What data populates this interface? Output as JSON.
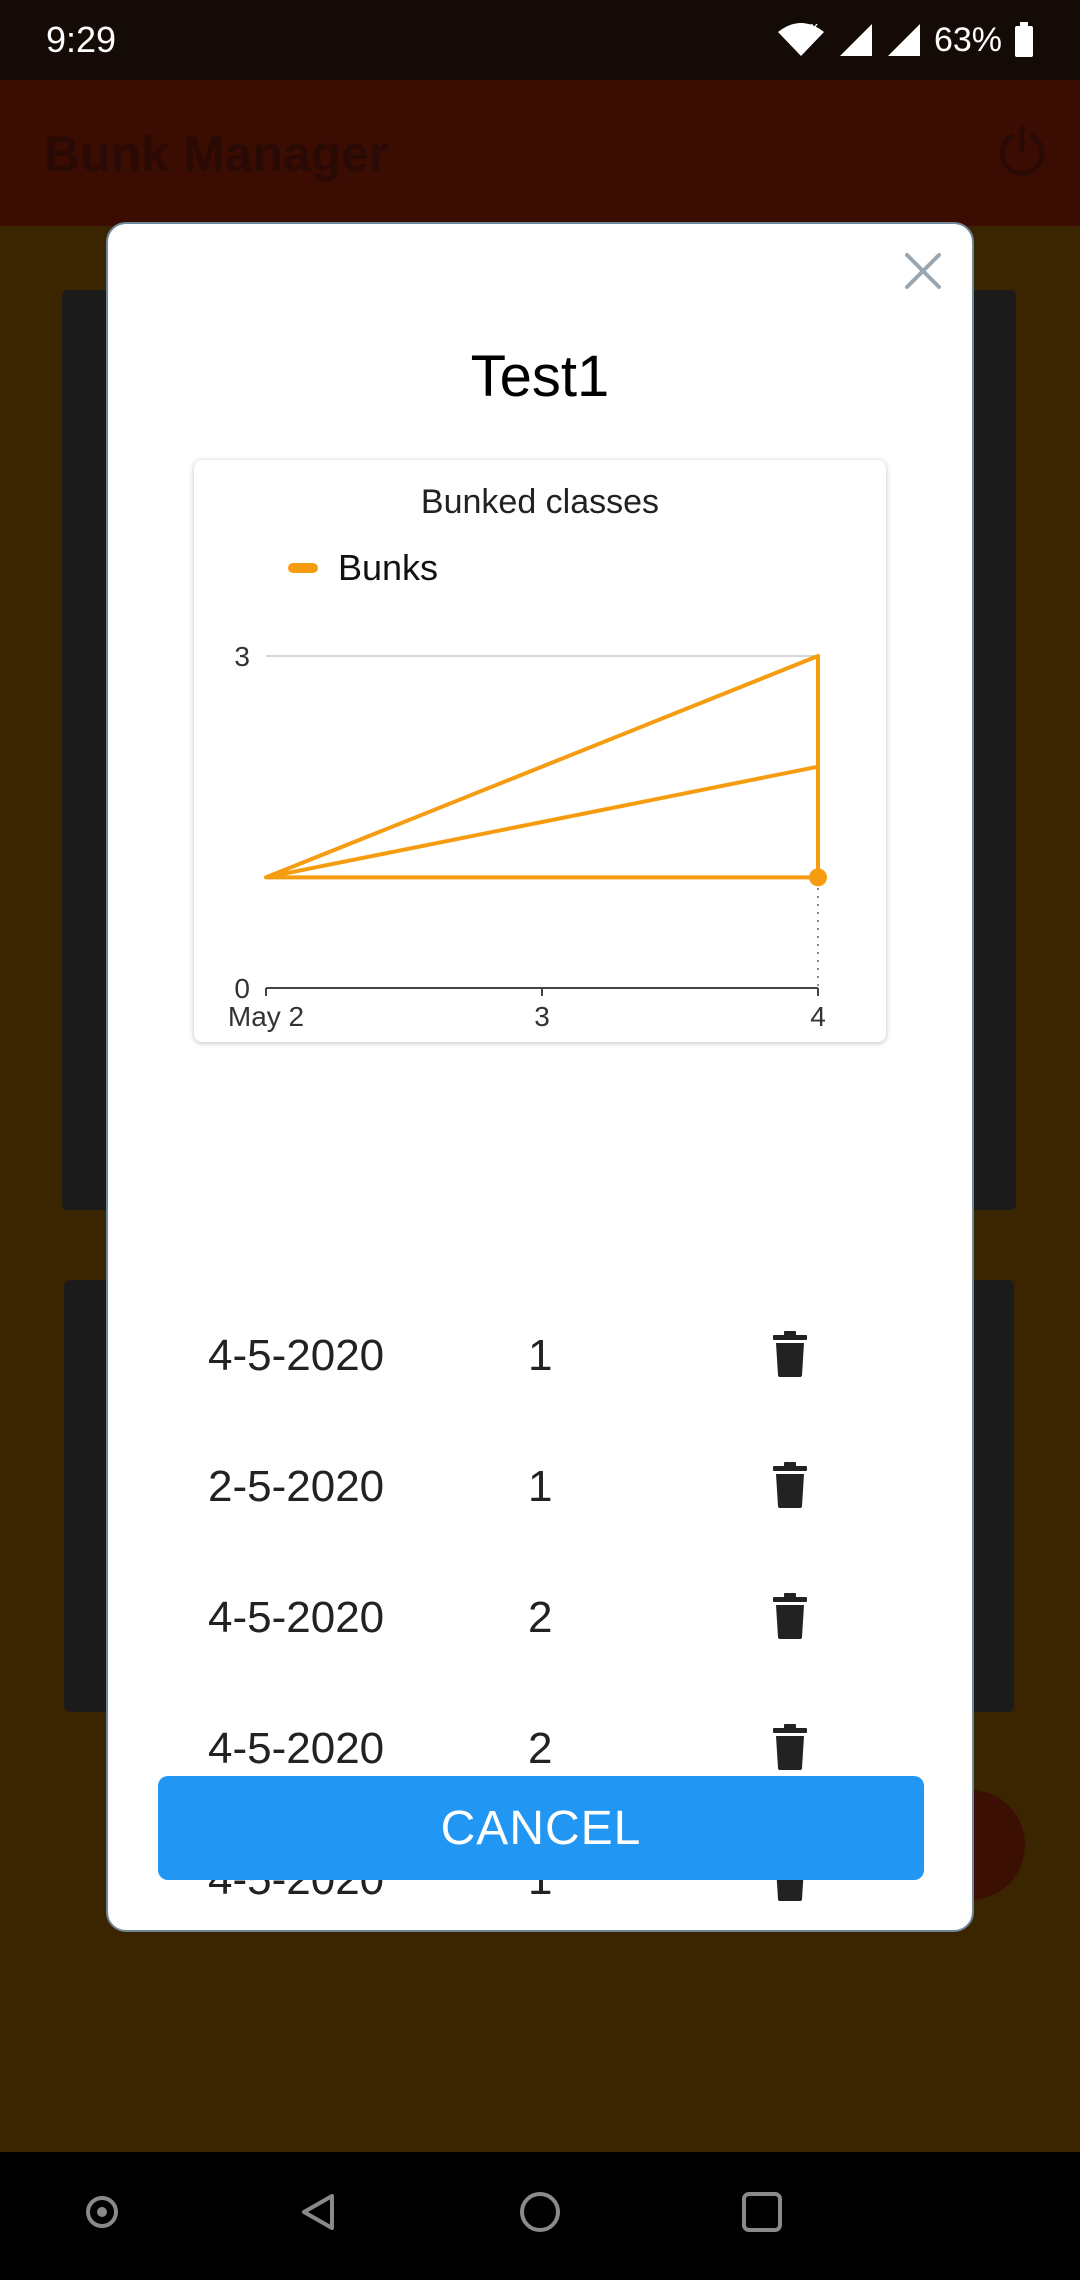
{
  "status_bar": {
    "time": "9:29",
    "battery": "63%",
    "icons": [
      "wifi-icon",
      "signal-icon",
      "signal-icon",
      "battery-icon"
    ]
  },
  "app": {
    "title": "Bunk Manager",
    "icons": [
      "power-icon"
    ]
  },
  "dialog": {
    "title": "Test1",
    "close_icon": "close-icon",
    "chart_title": "Bunked classes",
    "legend_label": "Bunks",
    "cancel_label": "CANCEL",
    "entries": [
      {
        "date": "4-5-2020",
        "count": "1"
      },
      {
        "date": "2-5-2020",
        "count": "1"
      },
      {
        "date": "4-5-2020",
        "count": "2"
      },
      {
        "date": "4-5-2020",
        "count": "2"
      },
      {
        "date": "4-5-2020",
        "count": "1"
      }
    ]
  },
  "chart_data": {
    "type": "line",
    "title": "Bunked classes",
    "x_ticks": [
      "May 2",
      "3",
      "4"
    ],
    "y_ticks": [
      "0",
      "3"
    ],
    "ylim": [
      0,
      3
    ],
    "xlim": [
      "May 2",
      "May 4"
    ],
    "series": [
      {
        "name": "Bunks",
        "color": "#f59c10",
        "points": [
          {
            "x": "May 2",
            "y": 1
          },
          {
            "x": "May 4",
            "y": 1
          },
          {
            "x": "May 4",
            "y": 2
          },
          {
            "x": "May 4",
            "y": 3
          },
          {
            "x": "May 2",
            "y": 1
          },
          {
            "x": "May 4",
            "y": 2
          },
          {
            "x": "May 4",
            "y": 1
          }
        ]
      }
    ],
    "highlighted_point": {
      "x": "May 4",
      "y": 1
    },
    "grid": "horizontal",
    "legend_position": "top-left"
  },
  "colors": {
    "accent": "#f59c10",
    "primary_button": "#2196f3",
    "app_bar": "#3b0d02"
  }
}
